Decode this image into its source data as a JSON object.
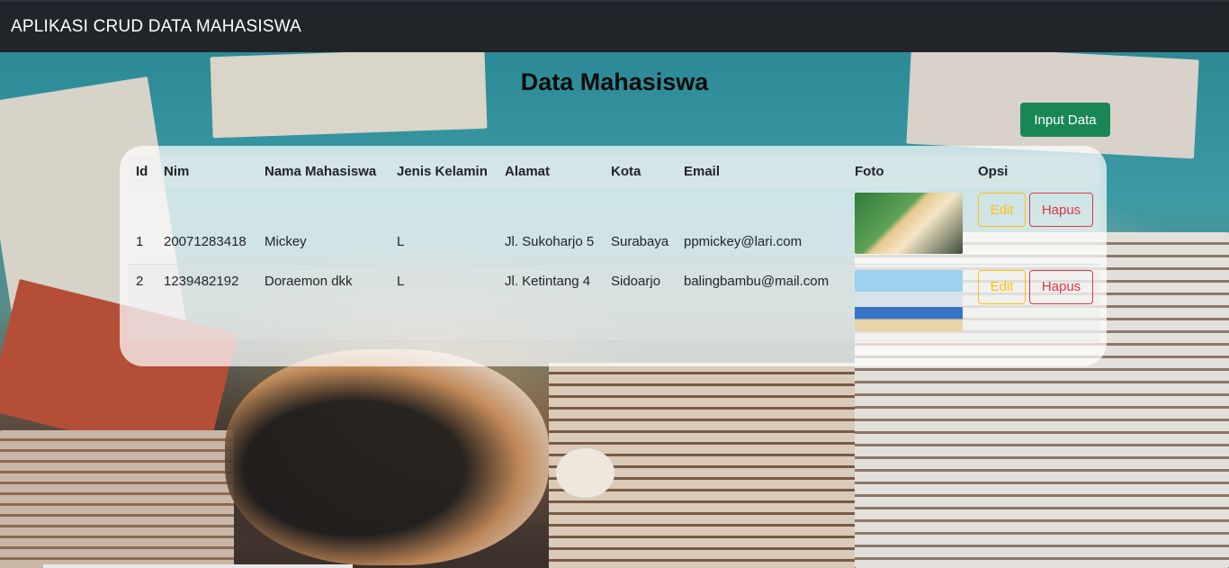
{
  "navbar": {
    "brand": "APLIKASI CRUD DATA MAHASISWA"
  },
  "page": {
    "title": "Data Mahasiswa",
    "input_button": "Input Data"
  },
  "table": {
    "headers": [
      "Id",
      "Nim",
      "Nama Mahasiswa",
      "Jenis Kelamin",
      "Alamat",
      "Kota",
      "Email",
      "Foto",
      "Opsi"
    ],
    "rows": [
      {
        "id": "1",
        "nim": "20071283418",
        "nama": "Mickey",
        "jk": "L",
        "alamat": "Jl. Sukoharjo 5",
        "kota": "Surabaya",
        "email": "ppmickey@lari.com",
        "foto_icon": "anime-character-photo",
        "edit": "Edit",
        "hapus": "Hapus"
      },
      {
        "id": "2",
        "nim": "1239482192",
        "nama": "Doraemon dkk",
        "jk": "L",
        "alamat": "Jl. Ketintang 4",
        "kota": "Sidoarjo",
        "email": "balingbambu@mail.com",
        "foto_icon": "cartoon-group-photo",
        "edit": "Edit",
        "hapus": "Hapus"
      }
    ]
  },
  "colors": {
    "navbar": "#212529",
    "primary_success": "#198754",
    "warning": "#ffc107",
    "danger": "#dc3545"
  }
}
